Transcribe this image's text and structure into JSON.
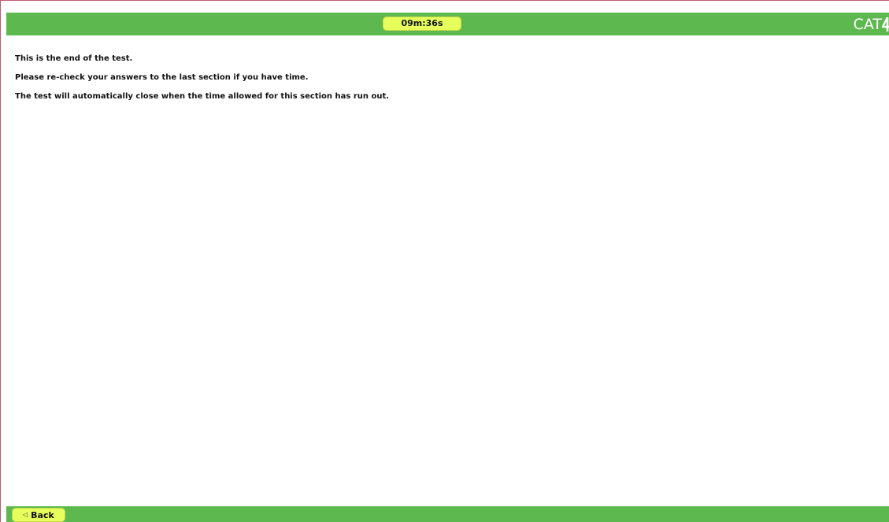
{
  "header": {
    "timer": "09m:36s",
    "logo_text": "CAT"
  },
  "content": {
    "lines": [
      "This is the end of the test.",
      "Please re-check your answers to the last section if you have time.",
      "The test will automatically close when the time allowed for this section has run out."
    ]
  },
  "footer": {
    "back_label": "Back",
    "back_icon": "triangle-left-icon"
  },
  "colors": {
    "bar_green": "#5db94f",
    "button_yellow": "#e6ff5c",
    "text": "#111111"
  }
}
